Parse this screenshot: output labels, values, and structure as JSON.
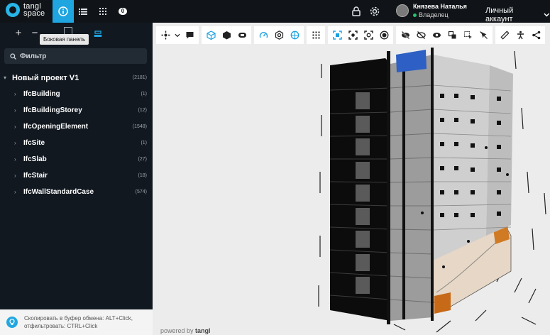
{
  "app": {
    "logo_line1": "tangl",
    "logo_line2": "space"
  },
  "topbar": {
    "tab_badge": "0",
    "user_name": "Князева Наталья",
    "user_role": "Владелец",
    "account_label": "Личный аккаунт"
  },
  "sidebar": {
    "tooltip": "Боковая панель",
    "filter_placeholder": "Фильтр",
    "tree": [
      {
        "label": "Новый проект V1",
        "count": "(2181)",
        "root": true
      },
      {
        "label": "IfcBuilding",
        "count": "(1)"
      },
      {
        "label": "IfcBuildingStorey",
        "count": "(12)"
      },
      {
        "label": "IfcOpeningElement",
        "count": "(1548)"
      },
      {
        "label": "IfcSite",
        "count": "(1)"
      },
      {
        "label": "IfcSlab",
        "count": "(27)"
      },
      {
        "label": "IfcStair",
        "count": "(18)"
      },
      {
        "label": "IfcWallStandardCase",
        "count": "(574)"
      }
    ],
    "hint_line1": "Скопировать в буфер обмена: ALT+Click,",
    "hint_line2": "отфильтровать: CTRL+Click"
  },
  "viewer": {
    "powered_prefix": "powered by",
    "powered_brand": "tangl"
  },
  "colors": {
    "accent": "#1fa5e0",
    "sidebar_bg": "#111820",
    "topbar_bg": "#101418"
  }
}
